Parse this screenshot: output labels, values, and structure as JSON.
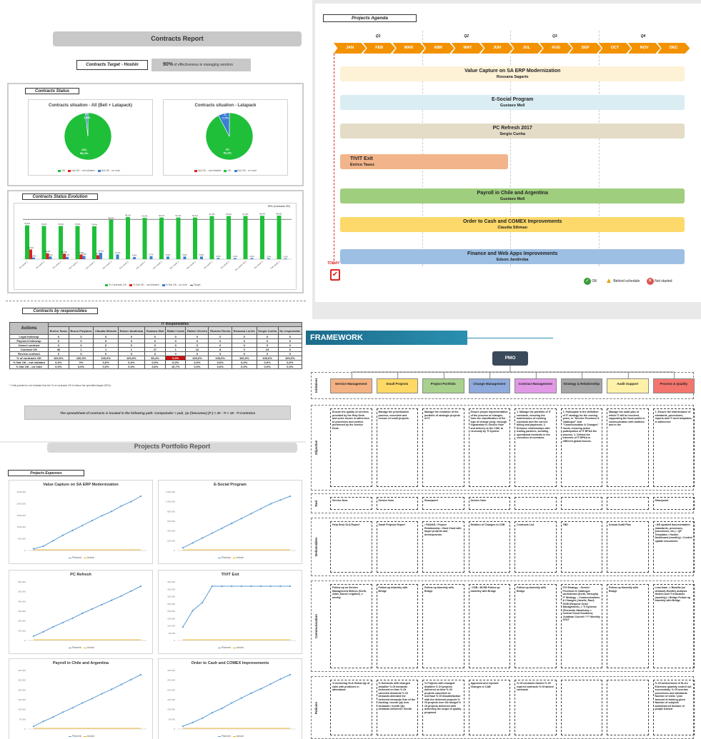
{
  "contracts_report": {
    "title": "Contracts Report",
    "target_label": "Contracts Target - Hoshin",
    "target_value": "90%",
    "target_text": "of effectiveness in managing vendors",
    "status_label": "Contracts Status",
    "pie_all": {
      "title": "Contracts situation - All (Bell + Latapack)",
      "slices": [
        {
          "label": "125; 98,4%",
          "value": 98.4,
          "color": "#1fbf3a"
        },
        {
          "label": "2; 1,6%",
          "value": 1.6,
          "color": "#3a7fd5"
        }
      ],
      "legend": [
        "OK",
        "Not OK - not initiated",
        "Not OK - on hold"
      ]
    },
    "pie_latapack": {
      "title": "Contracts situation - Latapack",
      "slices": [
        {
          "label": "24; 92,3%",
          "value": 92.3,
          "color": "#1fbf3a"
        },
        {
          "label": "2; 7,7%",
          "value": 7.7,
          "color": "#3a7fd5"
        }
      ],
      "legend": [
        "Not OK - not initiated",
        "OK",
        "Not OK - on hold"
      ]
    },
    "evolution_label": "Contracts Status Evolution",
    "evolution_chart": {
      "type": "bar",
      "note": "90% (Contracts OK)",
      "categories": [
        "Oct week 2",
        "Oct week 3",
        "Oct week 4",
        "Nov week 1",
        "Nov week 2",
        "Nov week 3",
        "Nov week 4",
        "Dec week 1",
        "Dec week 2",
        "Dec week 3",
        "Dec week 4",
        "Jan week 1",
        "Jan week 2",
        "Jan_week 3(2)",
        "Jan week 4",
        "Feb week 1"
      ],
      "series": [
        {
          "name": "% Contracts OK",
          "color": "#1fbf3a",
          "values": [
            76.4,
            75.0,
            75.0,
            75.0,
            74.4,
            88.9,
            95.1,
            93.3,
            94.1,
            94.1,
            94.1,
            97.4,
            97.6,
            97.6,
            98.0,
            98.4
          ]
        },
        {
          "name": "% Not OK - not initiated",
          "color": "#e02020",
          "values": [
            22.0,
            13.4,
            12.5,
            10.6,
            9.1,
            0,
            0,
            0,
            0,
            0,
            0,
            0,
            0,
            0,
            0,
            0
          ]
        },
        {
          "name": "% Not OK - on hold",
          "color": "#3a7fd5",
          "values": [
            3.6,
            6.0,
            5.3,
            7.2,
            14.3,
            10.7,
            4.9,
            6.7,
            5.9,
            5.9,
            5.9,
            2.6,
            2.4,
            2.4,
            2.0,
            1.6
          ]
        }
      ],
      "target": 90,
      "legend": [
        "% Contracts OK",
        "% Not OK - not initiated",
        "% Not OK - on hold",
        "Target"
      ]
    },
    "responsibles_label": "Contracts by responsibles",
    "table": {
      "group_header": "IT Responsibles",
      "actions_header": "Actions",
      "columns": [
        "Enrico Tausz",
        "Bruno Polydoro",
        "Claudia Sthman",
        "Edson Jandiroba",
        "Gustavo Moll",
        "Rafael Costa",
        "Rafael Oliveira",
        "Ricardo Rocha",
        "Rossana Loreto",
        "Sérgio Cunha",
        "No responsible"
      ],
      "rows": [
        {
          "action": "Legal followup",
          "cells": [
            "0",
            "0",
            "0",
            "0",
            "0",
            "0",
            "0",
            "0",
            "0",
            "0",
            "0"
          ]
        },
        {
          "action": "Payment followup",
          "cells": [
            "0",
            "0",
            "0",
            "0",
            "0",
            "0",
            "0",
            "0",
            "0",
            "0",
            "0"
          ]
        },
        {
          "action": "Cancel contract",
          "cells": [
            "0",
            "0",
            "0",
            "0",
            "0",
            "0",
            "0",
            "0",
            "0",
            "0",
            "0"
          ]
        },
        {
          "action": "Contract OK",
          "cells": [
            "46",
            "1",
            "1",
            "1",
            "27",
            "1",
            "12",
            "8",
            "0",
            "24",
            "0"
          ]
        },
        {
          "action": "Review contract",
          "cells": [
            "0",
            "0",
            "0",
            "0",
            "0",
            "0",
            "0",
            "0",
            "0",
            "0",
            "0"
          ]
        },
        {
          "action": "% of contracts OK",
          "cells": [
            "100,0%",
            "100,0%",
            "100,0%",
            "100,0%",
            "96,4%",
            "0,0%",
            "100,0%",
            "100,0%",
            "100,0%",
            "100,0%",
            "100,0%"
          ]
        },
        {
          "action": "% Not OK - not initiated",
          "cells": [
            "0,0%",
            "0%",
            "0,0%",
            "0,0%",
            "0,0%",
            "0,0%",
            "0,0%",
            "0,0%",
            "0,0%",
            "0,0%",
            "0,0%"
          ]
        },
        {
          "action": "% Not OK - on hold",
          "cells": [
            "0,0%",
            "0,0%",
            "0,0%",
            "0,0%",
            "3,6%",
            "16,7%",
            "0,0%",
            "0,0%",
            "0,0%",
            "0,0%",
            "0,0%"
          ]
        }
      ],
      "footnote": "* Cells painted in red indicate that the % of contracts OK is below the specified target (90%).",
      "path_text": "The spreadsheet of contracts is located in the following path: Computador > pub_rjo (\\\\recumes) (F:) > 20 - TI > 18 - TI Contratos"
    }
  },
  "agenda": {
    "title": "Projects Agenda",
    "quarters": [
      "Q1",
      "Q2",
      "Q3",
      "Q4"
    ],
    "months": [
      "JAN",
      "FEB",
      "MAR",
      "ABR",
      "MAY",
      "JUN",
      "JUL",
      "AUG",
      "SEP",
      "OCT",
      "NOV",
      "DEC"
    ],
    "projects": [
      {
        "name": "Value Capture on SA ERP Modernization",
        "lead": "Rossana Sagario",
        "color": "#fdf1d6",
        "start": 0,
        "end": 12
      },
      {
        "name": "E-Social Program",
        "lead": "Gustavo Moll",
        "color": "#d9edf2",
        "start": 0,
        "end": 12
      },
      {
        "name": "PC Refresh 2017",
        "lead": "Sergio Cunha",
        "color": "#e4dcc6",
        "start": 0,
        "end": 12
      },
      {
        "name": "TIVIT Exit",
        "lead": "Enrico Tausz",
        "color": "#f2b48a",
        "start": 0,
        "end": 6
      },
      {
        "name": "Payroll in Chile and Argentina",
        "lead": "Gustavo Moll",
        "color": "#9fce7e",
        "start": 0,
        "end": 12
      },
      {
        "name": "Order to Cash and COMEX Improvements",
        "lead": "Claudia Sthman",
        "color": "#fcd96a",
        "start": 0,
        "end": 12
      },
      {
        "name": "Finance and Web Apps Improvements",
        "lead": "Edson Jandiroba",
        "color": "#9dbfe3",
        "start": 0,
        "end": 12
      }
    ],
    "today_label": "TODAY",
    "legend": [
      "OK",
      "Behind schedule",
      "Not started"
    ]
  },
  "portfolio": {
    "title": "Projects Portfolio Report",
    "expenses_label": "Projects Expenses",
    "charts": [
      {
        "title": "Value Capture on SA ERP Modernization",
        "yticks": [
          "2500.000",
          "2000.000",
          "1500.000",
          "1000.000",
          "500.000",
          "0"
        ],
        "planned": [
          0.03,
          0.08,
          0.18,
          0.28,
          0.37,
          0.46,
          0.55,
          0.64,
          0.72,
          0.82,
          0.9,
          1.0
        ],
        "actual": [
          0,
          0,
          0,
          0,
          0,
          0,
          0,
          0,
          0,
          0,
          0,
          0
        ]
      },
      {
        "title": "E-Social Program",
        "yticks": [
          "1.200.000",
          "1.000.000",
          "800.000",
          "600.000",
          "400.000",
          "200.000",
          "0"
        ],
        "planned": [
          0.05,
          0.14,
          0.23,
          0.32,
          0.41,
          0.5,
          0.59,
          0.68,
          0.77,
          0.86,
          0.93,
          1.0
        ],
        "actual": [
          0,
          0,
          0,
          0,
          0,
          0,
          0,
          0,
          0,
          0,
          0,
          0
        ]
      },
      {
        "title": "PC Refresh",
        "yticks": [
          "600.000",
          "500.000",
          "400.000",
          "300.000",
          "200.000",
          "100.000",
          "0"
        ],
        "planned": [
          0.08,
          0.16,
          0.25,
          0.33,
          0.41,
          0.5,
          0.58,
          0.66,
          0.74,
          0.82,
          0.91,
          1.0
        ],
        "actual": [
          0,
          0,
          0,
          0,
          0,
          0,
          0,
          0,
          0,
          0,
          0,
          0
        ]
      },
      {
        "title": "TIVIT Exit",
        "yticks": [
          "400.000",
          "350.000",
          "300.000",
          "250.000",
          "200.000",
          "150.000",
          "100.000",
          "50.000",
          "0"
        ],
        "planned": [
          0.25,
          0.55,
          0.7,
          1.0,
          1.0,
          1.0,
          1.0,
          1.0,
          1.0,
          1.0,
          1.0,
          1.0
        ],
        "actual": [
          0,
          0,
          0,
          0,
          0,
          0,
          0,
          0,
          0,
          0,
          0,
          0
        ]
      },
      {
        "title": "Payroll in Chile and Argentina",
        "yticks": [
          "300.000",
          "250.000",
          "200.000",
          "150.000",
          "100.000",
          "50.000",
          "0"
        ],
        "planned": [
          0.05,
          0.14,
          0.22,
          0.31,
          0.39,
          0.48,
          0.56,
          0.65,
          0.73,
          0.82,
          0.91,
          1.0
        ],
        "actual": [
          0,
          0,
          0,
          0,
          0,
          0,
          0,
          0,
          0,
          0,
          0,
          0
        ]
      },
      {
        "title": "Order to Cash and COMEX Improvements",
        "yticks": [
          "300.000",
          "250.000",
          "200.000",
          "150.000",
          "100.000",
          "50.000",
          "0"
        ],
        "planned": [
          0.05,
          0.12,
          0.2,
          0.3,
          0.38,
          0.48,
          0.57,
          0.66,
          0.74,
          0.83,
          0.92,
          1.0
        ],
        "actual": [
          0,
          0,
          0,
          0,
          0,
          0,
          0,
          0,
          0,
          0,
          0,
          0
        ]
      }
    ],
    "legend": [
      "Planned",
      "Actual"
    ]
  },
  "framework": {
    "title": "FRAMEWORK",
    "pmo": "PMO",
    "initiatives": [
      {
        "label": "Service Management",
        "color": "#f4b183"
      },
      {
        "label": "Small Projects",
        "color": "#ffd966"
      },
      {
        "label": "Project Portfolio",
        "color": "#a9d18e"
      },
      {
        "label": "Change Management",
        "color": "#8faadc"
      },
      {
        "label": "Contract Management",
        "color": "#e199e6"
      },
      {
        "label": "Strategy & Relationship",
        "color": "#a6a6a6"
      },
      {
        "label": "Audit Support",
        "color": "#fff2a8"
      },
      {
        "label": "Process & Quality",
        "color": "#f4756e"
      }
    ],
    "row_labels": [
      "Initiatives",
      "Objective",
      "Tool",
      "Deliverables",
      "Communication",
      "Policies"
    ],
    "objective": [
      "Ensure the quality of services provided by the Help Desk and solve issues in adherence to processes and metrics performed by the Service Desk.",
      "Manage the prioritization process, execution and closure of small projects.",
      "Manage the evolution of the portfolio of strategic projects of IT.",
      "Ensure proper implementation of the process of changes, from the classification of the type of change (seq), through registration in Service Now and delivery to the CSB, to necessity by TI System.",
      "1. Manage the portfolio of IT contracts, ensuring the maintenance of existing contracts and the correct billing and payments. 2. Enhance relationships with trading partners, avoiding operational incidents in the execution of contracts.",
      "1. Participate in the definition of IT strategy for the coming years, in \"Service Provision & Catalogue\" and \"Communication & Changes\" fronts, ensuring active participation of IT BP&A the process. 2. Defend the interests of IT BP&A in different global forums.",
      "Manage the audit plan of which IT will be involved, supporting the focal points in communication with auditors and in the",
      "1. Ensure the maintenance of standards, procedures, reports and IT work templates, in adherence"
    ],
    "tool": [
      "Service Now",
      "Service Now",
      "Sharepoint",
      "Service Now",
      "",
      "",
      "",
      "Sharepoint"
    ],
    "deliverables": [
      "Help Desk SLA Report",
      "Small Projects Report",
      "• RADAR • Project Relationship • Gant Chart with larger projects and developments",
      "Relation of Changes to CSB",
      "Contracts List",
      "TBD",
      "Annual Audit Plan",
      "• KB updated documentation (standards, processes, procedures, etc.) • QP Templates • Hoshin Dashboard (monthly) • Control update documents"
    ],
    "communication": [
      "Follow up on Service Management Metrics (Kerth, Allan, Daniel Leighton) -> weekly",
      "Follow up biweekly with Bridge",
      "Follow up biweekly with Bridge",
      "• CSB • BCSB Follow up biweekly with Bridge",
      "Follow up biweekly with Bridge",
      "ITS Strategy – Service Provision & Catalogue workstream (Kerth, Wesuyla) IT Strategy – Communications & Changes (Janelle, Raul) SOW (Request Order Management) -> TI Systems (Fernando Zabalinsky > Central Cloud Solutions) Jonathan Connell ??? Monthly AT&T",
      "Follow up biweekly with Bridge",
      "Lean team -> Brasília (on demand) Monthly analysis Hoshin and IT indicators (monthly) > Bridge Follow up biweekly with Bridge"
    ],
    "policies": [
      "% Achieving SLA Global qty of calls with problems in attendance",
      "% Demands with changed deadline % Of demands delivered on time % Of canceled demands % Of demands attended the delivered demands Size of the backlog / month Qty new demands / month Qty demands delivered / month",
      "% Projects with changed deadline % Of projects delivered on time % Of projects cancelled on overhaul % Of dissatisfaction with the delivered projects % Of projects over the budget % Of projects delivered with achieving the scope of quality proposed",
      "Approved and rejected Changes in CAB",
      "% Of contracts Hoshin % Of expired contracts % Of absent contracts",
      "",
      "",
      "% Of achievement of SLA's Extremes quantity control out successfully. % Of overdue procedures and standards Number of visits / year Amount of training given Number of subjects administered Number of people trained"
    ]
  }
}
